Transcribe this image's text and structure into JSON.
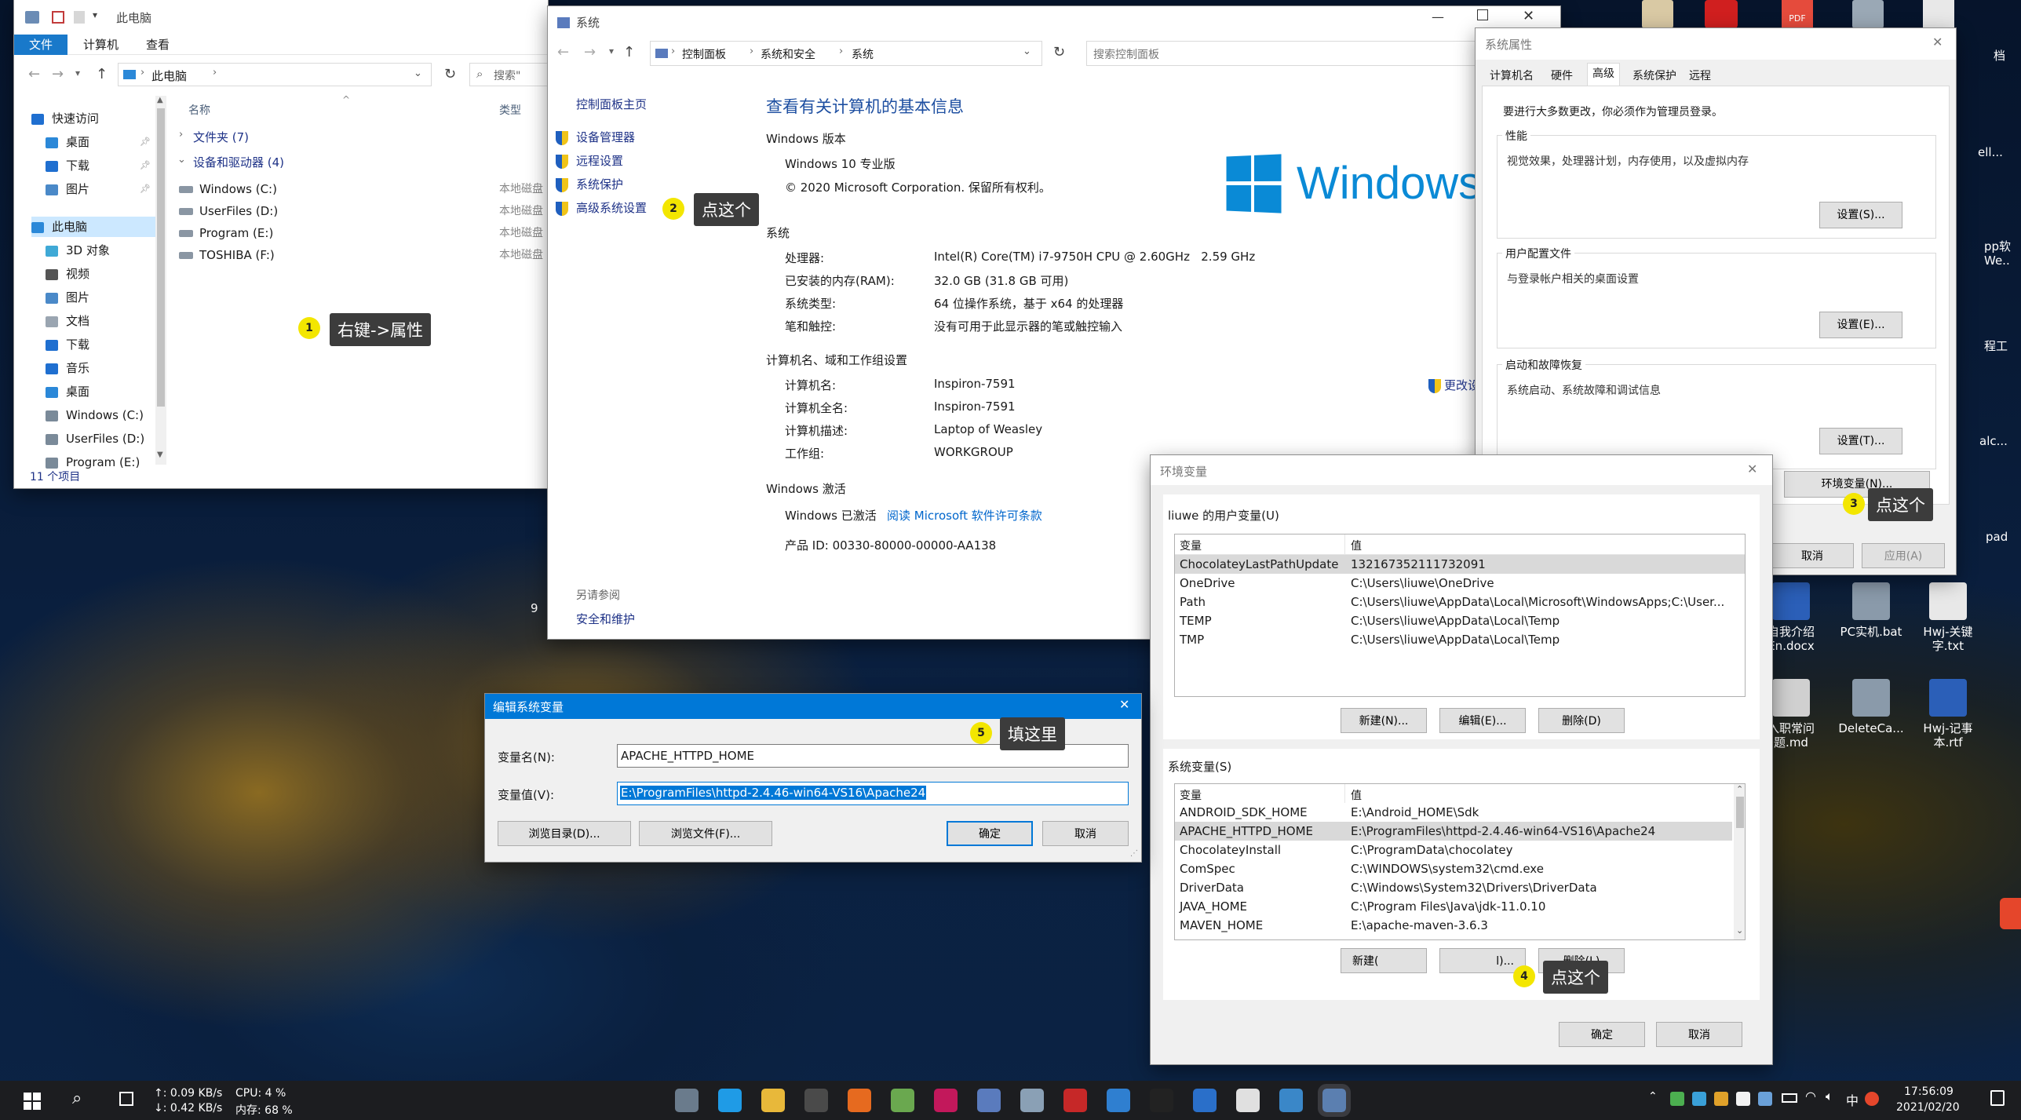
{
  "explorer": {
    "title": "此电脑",
    "ribbon_tabs": [
      "文件",
      "计算机",
      "查看"
    ],
    "address": "此电脑",
    "search_placeholder": "搜索\"",
    "col_name": "名称",
    "col_type": "类型",
    "group_folders": "文件夹 (7)",
    "group_drives": "设备和驱动器 (4)",
    "drives": [
      {
        "name": "Windows (C:)",
        "type": "本地磁盘"
      },
      {
        "name": "UserFiles (D:)",
        "type": "本地磁盘"
      },
      {
        "name": "Program (E:)",
        "type": "本地磁盘"
      },
      {
        "name": "TOSHIBA (F:)",
        "type": "本地磁盘"
      }
    ],
    "nav": [
      {
        "label": "快速访问",
        "icon": "star-icon",
        "color": "#1f6fd0"
      },
      {
        "label": "桌面",
        "icon": "desktop-icon",
        "color": "#2b88d8"
      },
      {
        "label": "下载",
        "icon": "download-icon",
        "color": "#1f6fd0"
      },
      {
        "label": "图片",
        "icon": "pictures-icon",
        "color": "#4a89c8"
      },
      {
        "label": "此电脑",
        "icon": "computer-icon",
        "color": "#2b88d8"
      },
      {
        "label": "3D 对象",
        "icon": "3d-objects-icon",
        "color": "#3fa9d6"
      },
      {
        "label": "视频",
        "icon": "videos-icon",
        "color": "#555555"
      },
      {
        "label": "图片",
        "icon": "pictures-icon",
        "color": "#4a89c8"
      },
      {
        "label": "文档",
        "icon": "documents-icon",
        "color": "#9aa5b1"
      },
      {
        "label": "下载",
        "icon": "download-icon",
        "color": "#1f6fd0"
      },
      {
        "label": "音乐",
        "icon": "music-icon",
        "color": "#1f6fd0"
      },
      {
        "label": "桌面",
        "icon": "desktop-icon",
        "color": "#2b88d8"
      },
      {
        "label": "Windows (C:)",
        "icon": "drive-icon",
        "color": "#7a8a99"
      },
      {
        "label": "UserFiles (D:)",
        "icon": "drive-icon",
        "color": "#7a8a99"
      },
      {
        "label": "Program (E:)",
        "icon": "drive-icon",
        "color": "#7a8a99"
      }
    ],
    "status": "11 个项目",
    "callout": "右键->属性",
    "marker": "1"
  },
  "system": {
    "title": "系统",
    "breadcrumb": [
      "控制面板",
      "系统和安全",
      "系统"
    ],
    "search_placeholder": "搜索控制面板",
    "side_home": "控制面板主页",
    "side_links": [
      "设备管理器",
      "远程设置",
      "系统保护",
      "高级系统设置"
    ],
    "see_also": "另请参阅",
    "see_also_link": "安全和维护",
    "heading": "查看有关计算机的基本信息",
    "edition_section": "Windows 版本",
    "edition": "Windows 10 专业版",
    "copyright": "© 2020 Microsoft Corporation. 保留所有权利。",
    "logo_text": "Windows",
    "system_section": "系统",
    "system_rows": [
      {
        "k": "处理器:",
        "v": "Intel(R) Core(TM) i7-9750H CPU @ 2.60GHz   2.59 GHz"
      },
      {
        "k": "已安装的内存(RAM):",
        "v": "32.0 GB (31.8 GB 可用)"
      },
      {
        "k": "系统类型:",
        "v": "64 位操作系统，基于 x64 的处理器"
      },
      {
        "k": "笔和触控:",
        "v": "没有可用于此显示器的笔或触控输入"
      }
    ],
    "name_section": "计算机名、域和工作组设置",
    "name_rows": [
      {
        "k": "计算机名:",
        "v": "Inspiron-7591"
      },
      {
        "k": "计算机全名:",
        "v": "Inspiron-7591"
      },
      {
        "k": "计算机描述:",
        "v": "Laptop of Weasley"
      },
      {
        "k": "工作组:",
        "v": "WORKGROUP"
      }
    ],
    "change_link": "更改设",
    "activation_section": "Windows 激活",
    "activated": "Windows 已激活",
    "license_link": "阅读 Microsoft 软件许可条款",
    "product_id": "产品 ID: 00330-80000-00000-AA138",
    "callout": "点这个",
    "marker": "2"
  },
  "sysprops": {
    "title": "系统属性",
    "tabs": [
      "计算机名",
      "硬件",
      "高级",
      "系统保护",
      "远程"
    ],
    "admin_note": "要进行大多数更改，你必须作为管理员登录。",
    "perf_title": "性能",
    "perf_desc": "视觉效果，处理器计划，内存使用，以及虚拟内存",
    "perf_btn": "设置(S)...",
    "profile_title": "用户配置文件",
    "profile_desc": "与登录帐户相关的桌面设置",
    "profile_btn": "设置(E)...",
    "startup_title": "启动和故障恢复",
    "startup_desc": "系统启动、系统故障和调试信息",
    "startup_btn": "设置(T)...",
    "env_btn": "环境变量(N)...",
    "cancel": "取消",
    "apply": "应用(A)",
    "callout": "点这个",
    "marker": "3"
  },
  "envvars": {
    "title": "环境变量",
    "user_label": "liuwe 的用户变量(U)",
    "col_var": "变量",
    "col_val": "值",
    "user_vars": [
      {
        "k": "ChocolateyLastPathUpdate",
        "v": "132167352111732091"
      },
      {
        "k": "OneDrive",
        "v": "C:\\Users\\liuwe\\OneDrive"
      },
      {
        "k": "Path",
        "v": "C:\\Users\\liuwe\\AppData\\Local\\Microsoft\\WindowsApps;C:\\User..."
      },
      {
        "k": "TEMP",
        "v": "C:\\Users\\liuwe\\AppData\\Local\\Temp"
      },
      {
        "k": "TMP",
        "v": "C:\\Users\\liuwe\\AppData\\Local\\Temp"
      }
    ],
    "user_new": "新建(N)...",
    "user_edit": "编辑(E)...",
    "user_delete": "删除(D)",
    "sys_label": "系统变量(S)",
    "sys_vars": [
      {
        "k": "ANDROID_SDK_HOME",
        "v": "E:\\Android_HOME\\Sdk"
      },
      {
        "k": "APACHE_HTTPD_HOME",
        "v": "E:\\ProgramFiles\\httpd-2.4.46-win64-VS16\\Apache24"
      },
      {
        "k": "ChocolateyInstall",
        "v": "C:\\ProgramData\\chocolatey"
      },
      {
        "k": "ComSpec",
        "v": "C:\\WINDOWS\\system32\\cmd.exe"
      },
      {
        "k": "DriverData",
        "v": "C:\\Windows\\System32\\Drivers\\DriverData"
      },
      {
        "k": "JAVA_HOME",
        "v": "C:\\Program Files\\Java\\jdk-11.0.10"
      },
      {
        "k": "MAVEN_HOME",
        "v": "E:\\apache-maven-3.6.3"
      }
    ],
    "sys_new": "新建(",
    "sys_edit": "l)...",
    "sys_delete": "删除(L)",
    "ok": "确定",
    "cancel": "取消",
    "callout": "点这个",
    "marker": "4"
  },
  "editvar": {
    "title": "编辑系统变量",
    "name_label": "变量名(N):",
    "name_value": "APACHE_HTTPD_HOME",
    "value_label": "变量值(V):",
    "value_value": "E:\\ProgramFiles\\httpd-2.4.46-win64-VS16\\Apache24",
    "browse_dir": "浏览目录(D)...",
    "browse_file": "浏览文件(F)...",
    "ok": "确定",
    "cancel": "取消",
    "callout": "填这里",
    "marker": "5"
  },
  "desktop_icons": [
    {
      "label": "自我介绍\nEn.docx",
      "icon": "word-doc-icon",
      "color": "#2b5fb8"
    },
    {
      "label": "PC实机.bat",
      "icon": "settings-file-icon",
      "color": "#8a9aaa"
    },
    {
      "label": "Hwj-关键字.txt",
      "icon": "text-file-icon",
      "color": "#e8e8e8"
    },
    {
      "label": "入职常问题.md",
      "icon": "markdown-icon",
      "color": "#d0d0d0"
    },
    {
      "label": "DeleteCa...",
      "icon": "settings-file-icon",
      "color": "#8a9aaa"
    },
    {
      "label": "Hwj-记事本.rtf",
      "icon": "word-doc-icon",
      "color": "#2b5fb8"
    }
  ],
  "desktop_cut_labels": [
    "档",
    "ell...",
    "pp软\nWe..",
    "程工",
    "alc...",
    "pad"
  ],
  "taskbar": {
    "net_up": "↑: 0.09 KB/s",
    "net_down": "↓: 0.42 KB/s",
    "cpu": "CPU: 4 %",
    "mem": "内存: 68 %",
    "time": "17:56:09",
    "date": "2021/02/20",
    "ime": "中",
    "app_icons": [
      {
        "name": "file-manager-icon",
        "color": "#6a7b8c"
      },
      {
        "name": "edge-icon",
        "color": "#1f9be6"
      },
      {
        "name": "folder-icon",
        "color": "#e8b83a"
      },
      {
        "name": "terminal-icon",
        "color": "#4a4a4a"
      },
      {
        "name": "firefox-icon",
        "color": "#e66a1f"
      },
      {
        "name": "notepadpp-icon",
        "color": "#6aa84f"
      },
      {
        "name": "intellij-icon",
        "color": "#c2185b"
      },
      {
        "name": "vmware-icon",
        "color": "#5a7bbd"
      },
      {
        "name": "screenshot-icon",
        "color": "#8aa0b5"
      },
      {
        "name": "app-red-icon",
        "color": "#c62828"
      },
      {
        "name": "chrome-icon",
        "color": "#2f7fd0"
      },
      {
        "name": "cmd-icon",
        "color": "#222222"
      },
      {
        "name": "thunderbird-icon",
        "color": "#2a6fc9"
      },
      {
        "name": "typora-icon",
        "color": "#e0e0e0"
      },
      {
        "name": "remote-desktop-icon",
        "color": "#3a87c8"
      },
      {
        "name": "control-panel-icon",
        "color": "#5b7fb0"
      }
    ]
  },
  "colors": {
    "accent": "#0078d7",
    "link": "#0066cc",
    "marker": "#f3e600",
    "callout_bg": "#3c3c3c",
    "selection": "#0078d7"
  }
}
